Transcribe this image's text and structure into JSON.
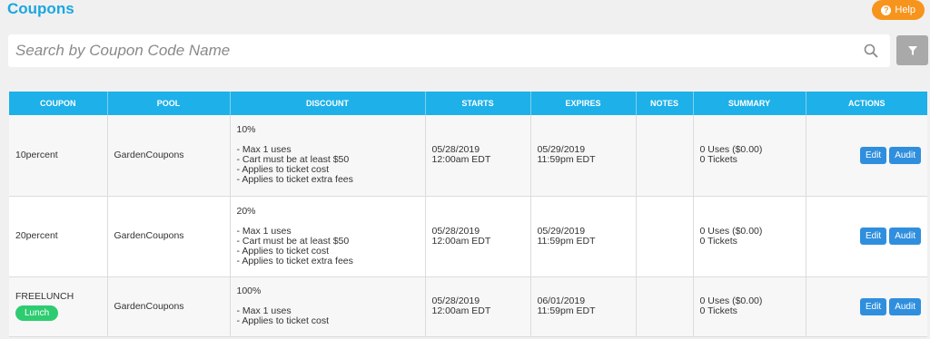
{
  "page": {
    "title": "Coupons",
    "help_label": "Help"
  },
  "search": {
    "placeholder": "Search by Coupon Code Name"
  },
  "table": {
    "headers": [
      "COUPON",
      "POOL",
      "DISCOUNT",
      "STARTS",
      "EXPIRES",
      "NOTES",
      "SUMMARY",
      "ACTIONS"
    ],
    "rows": [
      {
        "coupon": "10percent",
        "pool": "GardenCoupons",
        "discount_pct": "10%",
        "discount_rules": [
          "- Max 1 uses",
          "- Cart must be at least $50",
          "- Applies to ticket cost",
          "- Applies to ticket extra fees"
        ],
        "starts_date": "05/28/2019",
        "starts_time": "12:00am EDT",
        "expires_date": "05/29/2019",
        "expires_time": "11:59pm EDT",
        "notes": "",
        "summary_uses": "0 Uses ($0.00)",
        "summary_tickets": "0 Tickets",
        "edit_label": "Edit",
        "audit_label": "Audit"
      },
      {
        "coupon": "20percent",
        "pool": "GardenCoupons",
        "discount_pct": "20%",
        "discount_rules": [
          "- Max 1 uses",
          "- Cart must be at least $50",
          "- Applies to ticket cost",
          "- Applies to ticket extra fees"
        ],
        "starts_date": "05/28/2019",
        "starts_time": "12:00am EDT",
        "expires_date": "05/29/2019",
        "expires_time": "11:59pm EDT",
        "notes": "",
        "summary_uses": "0 Uses ($0.00)",
        "summary_tickets": "0 Tickets",
        "edit_label": "Edit",
        "audit_label": "Audit"
      },
      {
        "coupon": "FREELUNCH",
        "tag": "Lunch",
        "pool": "GardenCoupons",
        "discount_pct": "100%",
        "discount_rules": [
          "- Max 1 uses",
          "- Applies to ticket cost"
        ],
        "starts_date": "05/28/2019",
        "starts_time": "12:00am EDT",
        "expires_date": "06/01/2019",
        "expires_time": "11:59pm EDT",
        "notes": "",
        "summary_uses": "0 Uses ($0.00)",
        "summary_tickets": "0 Tickets",
        "edit_label": "Edit",
        "audit_label": "Audit"
      }
    ]
  },
  "colors": {
    "accent": "#1eb0e8",
    "help": "#f7941d",
    "action": "#2f8fde",
    "tag": "#2ecc71"
  }
}
